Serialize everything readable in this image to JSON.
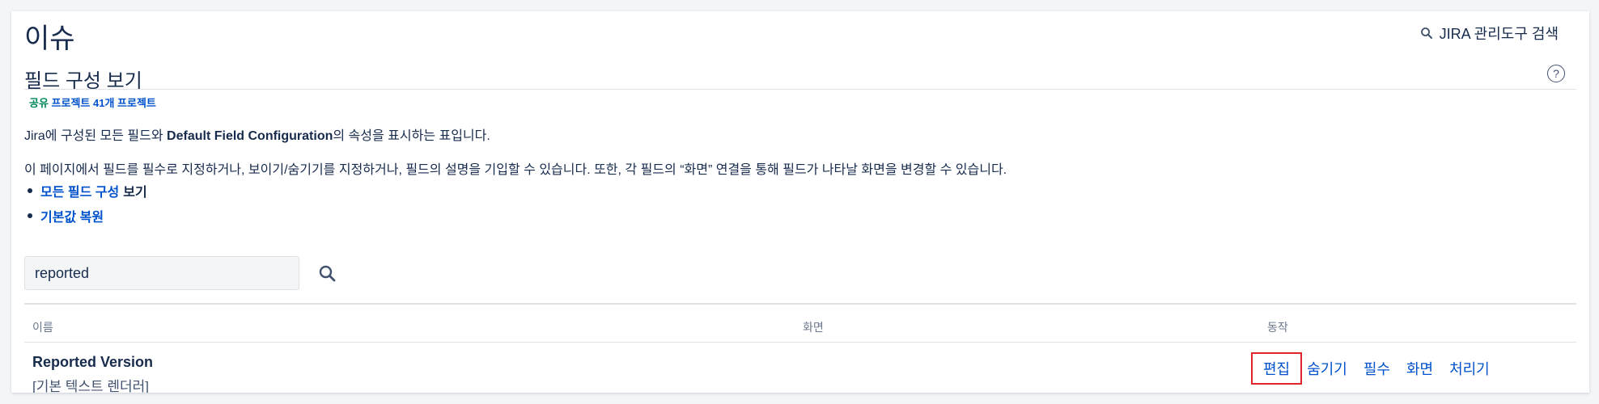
{
  "header": {
    "title": "이슈",
    "admin_search_label": "JIRA 관리도구 검색"
  },
  "section": {
    "title": "필드 구성 보기",
    "shared_prefix": "공유",
    "shared_projects": "프로젝트 41개 프로젝트",
    "description_pre": "Jira에 구성된 모든 필드와 ",
    "description_bold": "Default Field Configuration",
    "description_post": "의 속성을 표시하는 표입니다.",
    "instructions": "이 페이지에서 필드를 필수로 지정하거나, 보이기/숨기기를 지정하거나, 필드의 설명을 기입할 수 있습니다. 또한, 각 필드의 “화면” 연결을 통해 필드가 나타날 화면을 변경할 수 있습니다.",
    "links": {
      "view_all_link": "모든 필드 구성",
      "view_all_suffix": "보기",
      "restore_defaults": "기본값 복원"
    }
  },
  "search": {
    "value": "reported",
    "icon": "search-icon"
  },
  "table": {
    "columns": [
      "이름",
      "화면",
      "동작"
    ],
    "rows": [
      {
        "name": "Reported Version",
        "renderer": "[기본 텍스트 렌더러]",
        "actions": [
          "편집",
          "숨기기",
          "필수",
          "화면",
          "처리기"
        ]
      }
    ]
  },
  "colors": {
    "link": "#0052cc",
    "shared_green": "#00875a",
    "highlight_border": "#e3242b",
    "text": "#172b4d"
  }
}
